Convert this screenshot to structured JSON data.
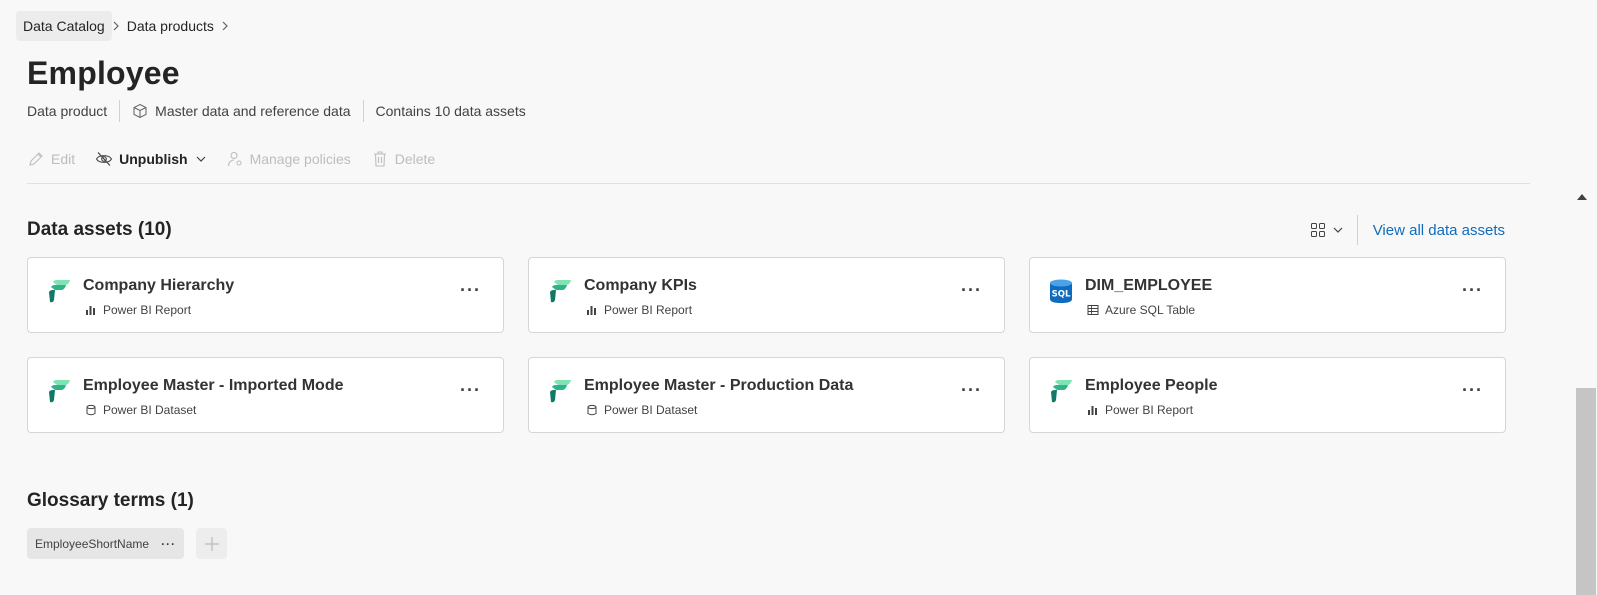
{
  "breadcrumb": {
    "items": [
      "Data Catalog",
      "Data products"
    ],
    "separator": ">"
  },
  "page": {
    "title": "Employee",
    "meta": {
      "type": "Data product",
      "domain": "Master data and reference data",
      "assets_count": "Contains 10 data assets"
    }
  },
  "toolbar": {
    "edit": "Edit",
    "unpublish": "Unpublish",
    "manage_policies": "Manage policies",
    "delete": "Delete"
  },
  "data_assets": {
    "title": "Data assets (10)",
    "view_all": "View all data assets",
    "items": [
      {
        "name": "Company Hierarchy",
        "type": "Power BI Report",
        "icon": "fabric-icon",
        "type_icon": "bar-chart-icon"
      },
      {
        "name": "Company KPIs",
        "type": "Power BI Report",
        "icon": "fabric-icon",
        "type_icon": "bar-chart-icon"
      },
      {
        "name": "DIM_EMPLOYEE",
        "type": "Azure SQL Table",
        "icon": "sql-icon",
        "type_icon": "table-icon"
      },
      {
        "name": "Employee Master - Imported Mode",
        "type": "Power BI Dataset",
        "icon": "fabric-icon",
        "type_icon": "database-icon"
      },
      {
        "name": "Employee Master - Production Data",
        "type": "Power BI Dataset",
        "icon": "fabric-icon",
        "type_icon": "database-icon"
      },
      {
        "name": "Employee People",
        "type": "Power BI Report",
        "icon": "fabric-icon",
        "type_icon": "bar-chart-icon"
      }
    ],
    "more": "···"
  },
  "glossary": {
    "title": "Glossary terms (1)",
    "terms": [
      "EmployeeShortName"
    ],
    "more": "···"
  },
  "sql_badge": "SQL",
  "colors": {
    "link": "#0f6cbd",
    "text": "#242424",
    "disabled": "#bdbdbd",
    "fabric_green_light": "#7fe3b4",
    "fabric_green_dark": "#117865",
    "sql_blue": "#0f6cbd"
  }
}
